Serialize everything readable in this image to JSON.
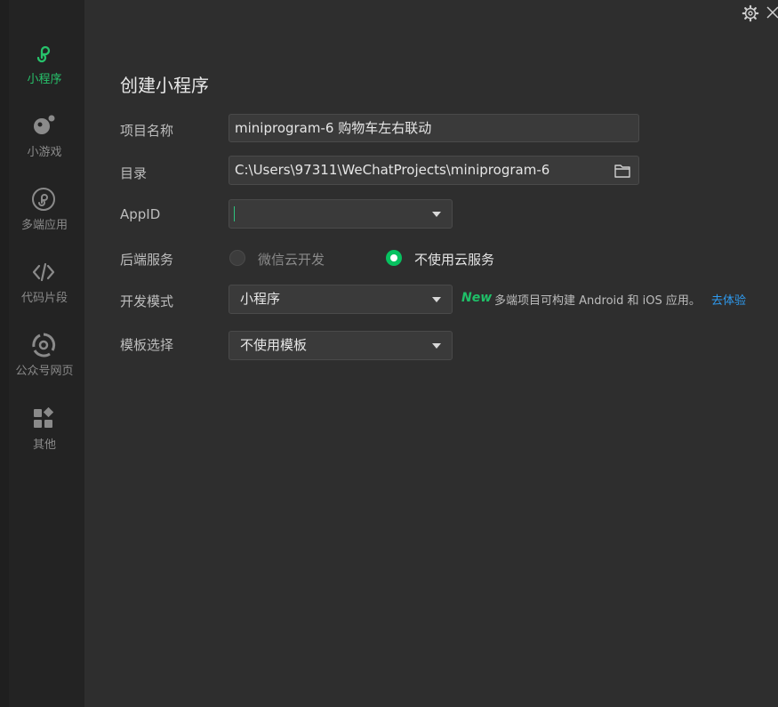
{
  "sidebar": {
    "items": [
      {
        "label": "小程序",
        "icon": "miniprogram-icon",
        "active": true
      },
      {
        "label": "小游戏",
        "icon": "minigame-icon",
        "active": false
      },
      {
        "label": "多端应用",
        "icon": "multiplatform-icon",
        "active": false
      },
      {
        "label": "代码片段",
        "icon": "code-icon",
        "active": false
      },
      {
        "label": "公众号网页",
        "icon": "official-account-icon",
        "active": false
      },
      {
        "label": "其他",
        "icon": "apps-icon",
        "active": false
      }
    ]
  },
  "header": {
    "settings_icon": "gear-icon",
    "close_icon": "close-icon"
  },
  "form": {
    "title": "创建小程序",
    "project_name": {
      "label": "项目名称",
      "value": "miniprogram-6 购物车左右联动"
    },
    "directory": {
      "label": "目录",
      "value": "C:\\Users\\97311\\WeChatProjects\\miniprogram-6"
    },
    "appid": {
      "label": "AppID",
      "value": ""
    },
    "backend": {
      "label": "后端服务",
      "options": [
        {
          "label": "微信云开发",
          "selected": false
        },
        {
          "label": "不使用云服务",
          "selected": true
        }
      ]
    },
    "dev_mode": {
      "label": "开发模式",
      "value": "小程序",
      "new_badge": "New",
      "hint": "多端项目可构建 Android 和 iOS 应用。",
      "hint_link": "去体验"
    },
    "template": {
      "label": "模板选择",
      "value": "不使用模板"
    }
  },
  "colors": {
    "accent_green": "#07c160",
    "link_blue": "#2e9bf0",
    "background": "#2e2e2e",
    "sidebar": "#232323"
  }
}
